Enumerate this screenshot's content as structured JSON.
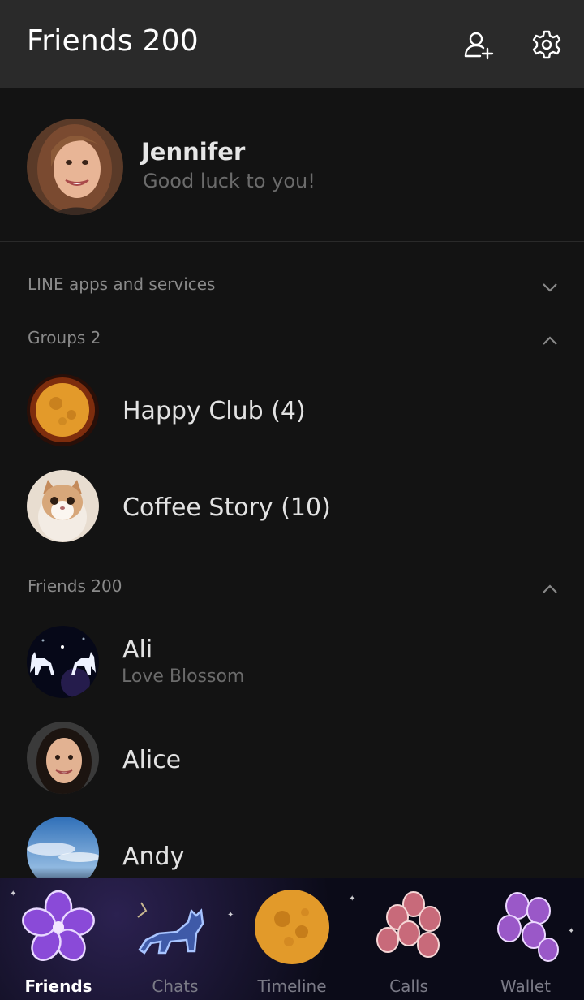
{
  "header": {
    "title": "Friends 200",
    "add_friend_icon": "person-plus-icon",
    "settings_icon": "gear-icon"
  },
  "profile": {
    "name": "Jennifer",
    "status": "Good luck to you!"
  },
  "sections": {
    "line_apps": {
      "label": "LINE apps and services",
      "state": "collapsed"
    },
    "groups": {
      "label": "Groups 2",
      "state": "expanded"
    },
    "friends": {
      "label": "Friends 200",
      "state": "expanded"
    }
  },
  "groups": [
    {
      "name": "Happy Club (4)"
    },
    {
      "name": "Coffee Story (10)"
    }
  ],
  "friends": [
    {
      "name": "Ali",
      "status": "Love Blossom"
    },
    {
      "name": "Alice",
      "status": ""
    },
    {
      "name": "Andy",
      "status": ""
    }
  ],
  "tabs": [
    {
      "label": "Friends",
      "active": true
    },
    {
      "label": "Chats",
      "active": false
    },
    {
      "label": "Timeline",
      "active": false
    },
    {
      "label": "Calls",
      "active": false
    },
    {
      "label": "Wallet",
      "active": false
    }
  ],
  "colors": {
    "header_bg": "#2a2a2a",
    "body_bg": "#131313",
    "active_tab_text": "#ffffff",
    "muted_text": "#6b6b6b"
  }
}
